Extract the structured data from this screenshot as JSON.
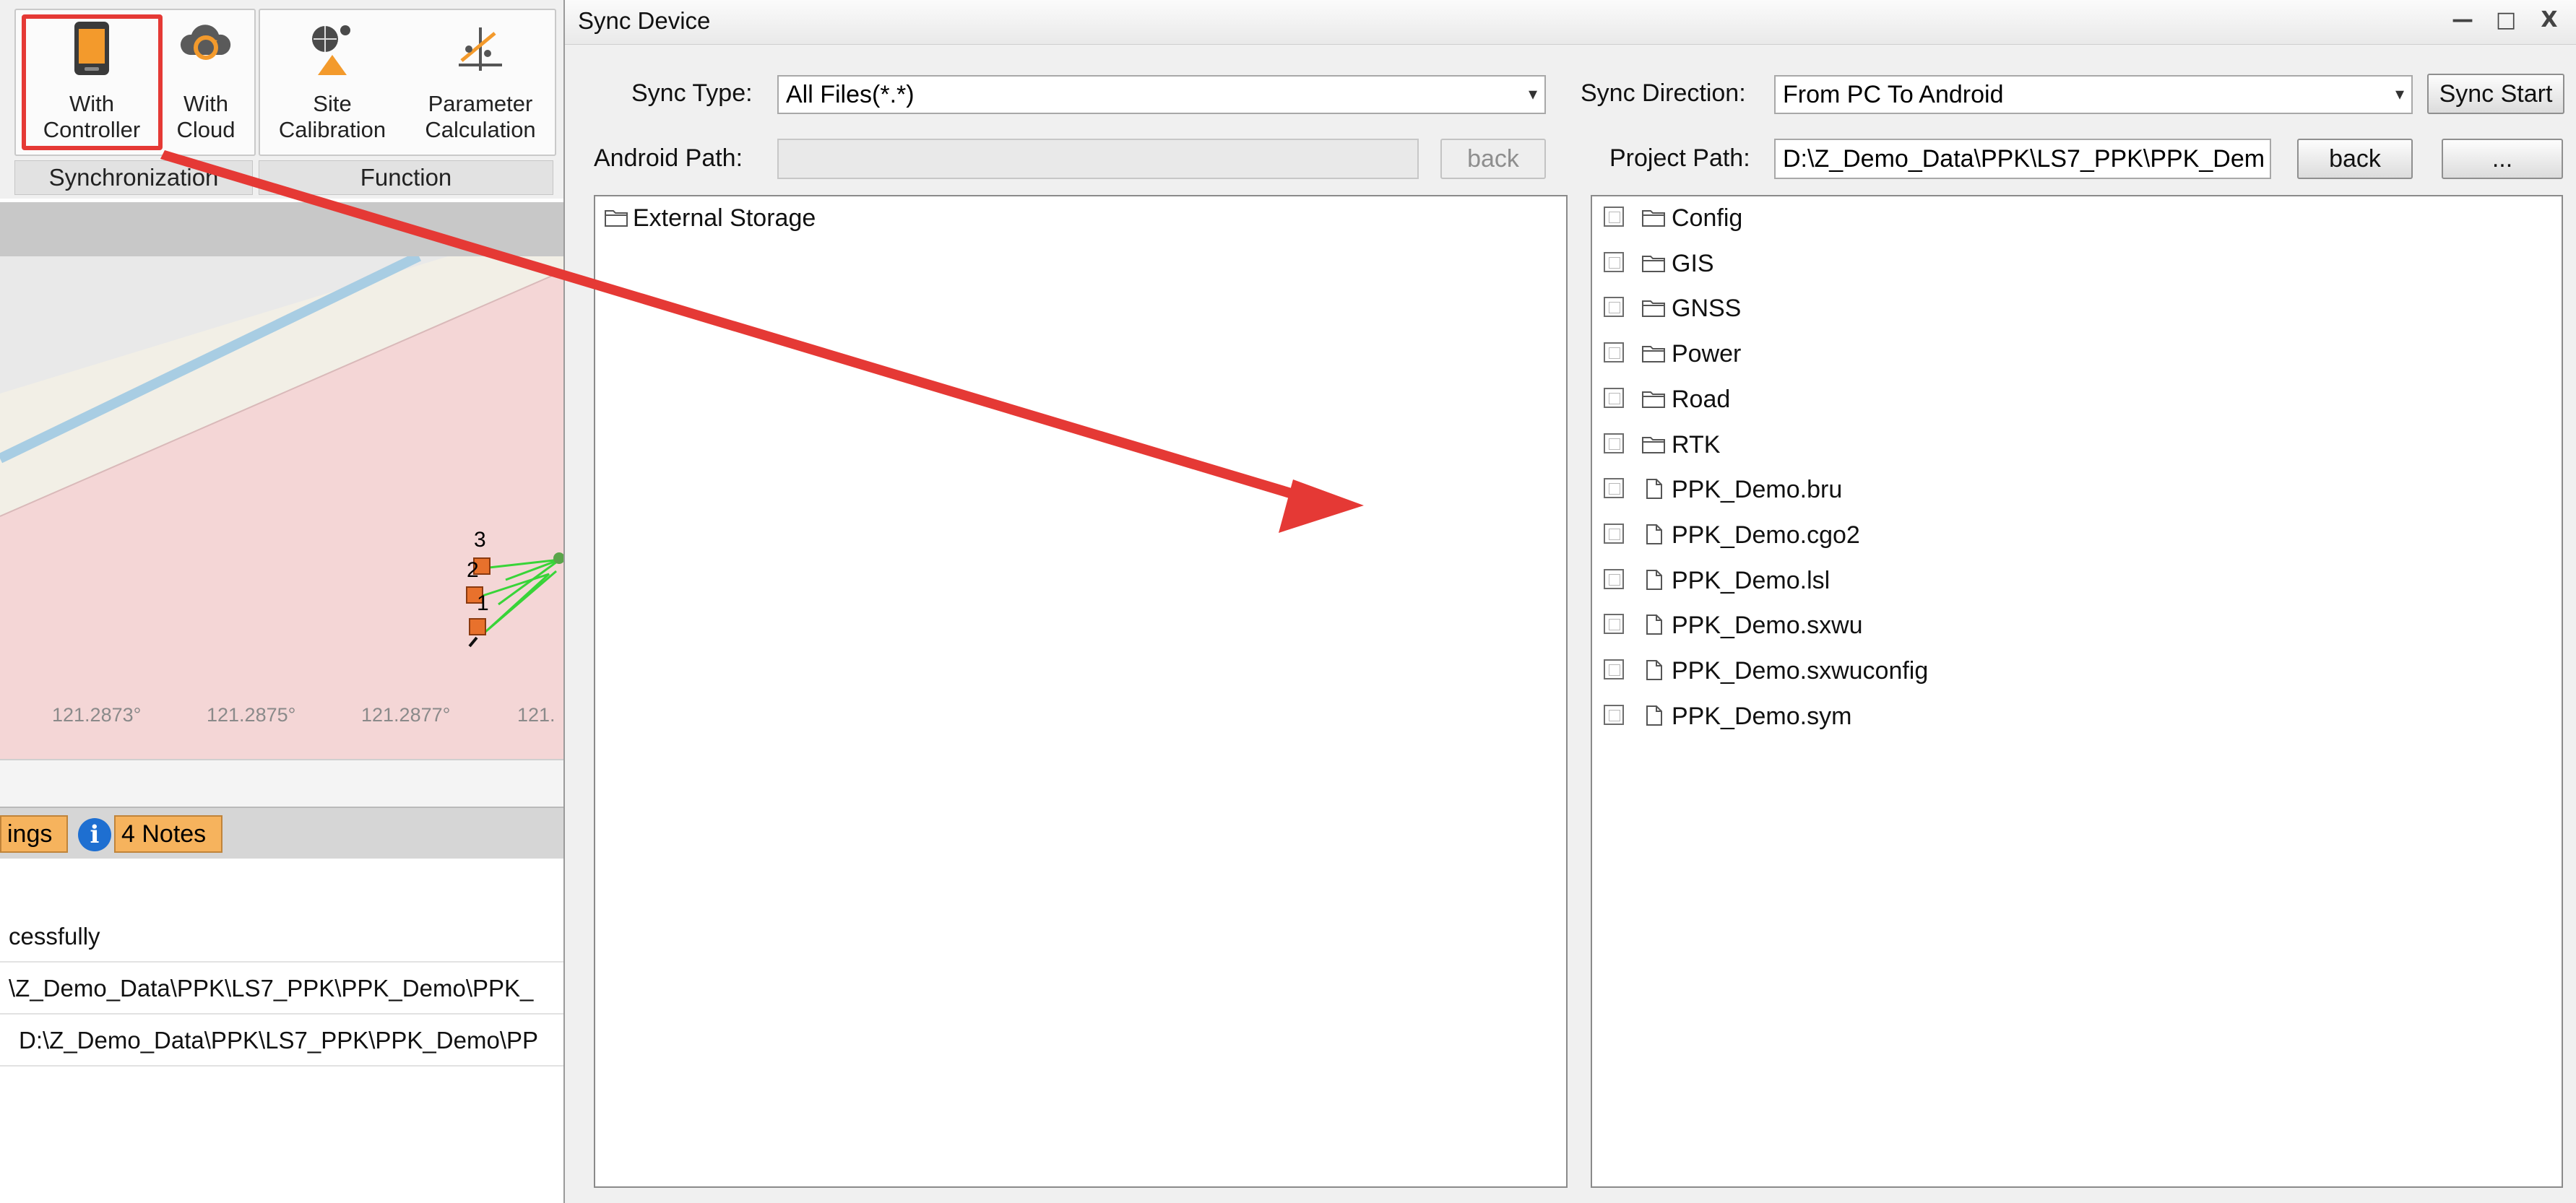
{
  "ribbon": {
    "groups": [
      {
        "label": "Synchronization"
      },
      {
        "label": "Function"
      }
    ],
    "buttons": {
      "with_controller": "With\nController",
      "with_cloud": "With\nCloud",
      "site_calibration": "Site\nCalibration",
      "parameter_calculation": "Parameter\nCalculation"
    }
  },
  "map": {
    "ticks": [
      "121.2873°",
      "121.2875°",
      "121.2877°",
      "121."
    ],
    "point_labels": [
      "3",
      "2",
      "1"
    ]
  },
  "statusbar": {
    "tab_partial": "ings",
    "notes": "4 Notes",
    "info_glyph": "i"
  },
  "log": {
    "rows": [
      "cessfully",
      "\\Z_Demo_Data\\PPK\\LS7_PPK\\PPK_Demo\\PPK_",
      "D:\\Z_Demo_Data\\PPK\\LS7_PPK\\PPK_Demo\\PP"
    ]
  },
  "dialog": {
    "title": "Sync Device",
    "controls": {
      "minimize": "—",
      "maximize": "□",
      "close": "X"
    },
    "sync_type_label": "Sync Type:",
    "sync_type_value": "All Files(*.*)",
    "sync_direction_label": "Sync Direction:",
    "sync_direction_value": "From PC To Android",
    "sync_start": "Sync Start",
    "android_path_label": "Android Path:",
    "android_path_value": "",
    "android_back": "back",
    "project_path_label": "Project Path:",
    "project_path_value": "D:\\Z_Demo_Data\\PPK\\LS7_PPK\\PPK_Dem",
    "project_back": "back",
    "browse": "...",
    "dropdown_glyph": "▾",
    "android_tree": [
      {
        "name": "External Storage",
        "type": "folder"
      }
    ],
    "project_tree": [
      {
        "name": "Config",
        "type": "folder"
      },
      {
        "name": "GIS",
        "type": "folder"
      },
      {
        "name": "GNSS",
        "type": "folder"
      },
      {
        "name": "Power",
        "type": "folder"
      },
      {
        "name": "Road",
        "type": "folder"
      },
      {
        "name": "RTK",
        "type": "folder"
      },
      {
        "name": "PPK_Demo.bru",
        "type": "file"
      },
      {
        "name": "PPK_Demo.cgo2",
        "type": "file"
      },
      {
        "name": "PPK_Demo.lsl",
        "type": "file"
      },
      {
        "name": "PPK_Demo.sxwu",
        "type": "file"
      },
      {
        "name": "PPK_Demo.sxwuconfig",
        "type": "file"
      },
      {
        "name": "PPK_Demo.sym",
        "type": "file"
      }
    ]
  },
  "colors": {
    "annotation_red": "#e53935",
    "map_fill": "#f4d6d6",
    "notes_tab": "#f6b35d"
  }
}
